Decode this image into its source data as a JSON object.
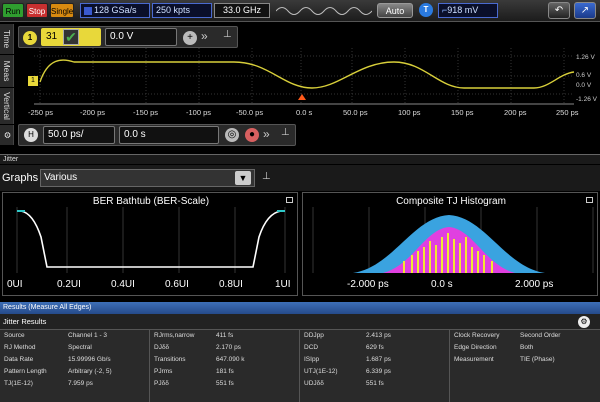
{
  "toolbar": {
    "run": "Run",
    "stop": "Stop",
    "single": "Single",
    "sample_rate": "128 GSa/s",
    "memory": "250 kpts",
    "bandwidth": "33.0 GHz",
    "auto": "Auto",
    "trigger_level": "918 mV"
  },
  "side_tabs": {
    "time": "Time",
    "meas": "Meas",
    "vertical": "Vertical"
  },
  "channel": {
    "offset_value": "0.0 V",
    "scale_value": "31"
  },
  "waveform": {
    "x_ticks": [
      "-250 ps",
      "-200 ps",
      "-150 ps",
      "-100 ps",
      "-50.0 ps",
      "0.0 s",
      "50.0 ps",
      "100 ps",
      "150 ps",
      "200 ps",
      "250 ps"
    ],
    "y_ticks": [
      "1.26 V",
      "0.6 V",
      "0.0 V",
      "-1.26 V"
    ],
    "marker": "1"
  },
  "horizontal": {
    "scale": "50.0 ps/",
    "position": "0.0 s",
    "h_label": "H"
  },
  "jitter": {
    "header": "Jitter",
    "graphs_label": "Graphs",
    "graphs_value": "Various",
    "bathtub": {
      "title": "BER Bathtub (BER-Scale)",
      "ticks": [
        "0UI",
        "0.2UI",
        "0.4UI",
        "0.6UI",
        "0.8UI",
        "1UI"
      ]
    },
    "histogram": {
      "title": "Composite TJ Histogram",
      "ticks": [
        "-2.000 ps",
        "0.0 s",
        "2.000 ps"
      ]
    }
  },
  "results": {
    "header": "Results   (Measure All Edges)",
    "subheader": "Jitter Results",
    "columns": [
      [
        [
          "Source",
          "Channel 1 - 3"
        ],
        [
          "RJ Method",
          "Spectral"
        ],
        [
          "Data Rate",
          "15.99996 Gb/s"
        ],
        [
          "Pattern Length",
          "Arbitrary (-2, 5)"
        ],
        [
          "TJ(1E-12)",
          "7.959 ps"
        ]
      ],
      [
        [
          "RJrms,narrow",
          "411 fs"
        ],
        [
          "DJδδ",
          "2.170 ps"
        ],
        [
          "Transitions",
          "647.090 k"
        ],
        [
          "PJrms",
          "181 fs"
        ],
        [
          "PJδδ",
          "551 fs"
        ]
      ],
      [
        [
          "DDJpp",
          "2.413 ps"
        ],
        [
          "DCD",
          "629 fs"
        ],
        [
          "ISIpp",
          "1.687 ps"
        ],
        [
          "UTJ(1E-12)",
          "6.339 ps"
        ],
        [
          "UDJδδ",
          "551 fs"
        ]
      ],
      [
        [
          "Clock Recovery",
          "Second Order"
        ],
        [
          "Edge Direction",
          "Both"
        ],
        [
          "Measurement",
          "TIE (Phase)"
        ],
        [
          "",
          ""
        ],
        [
          "",
          ""
        ]
      ]
    ]
  },
  "colors": {
    "waveform": "#d8cf3a",
    "trigger": "#ff5a1a",
    "histogram_base": "#3aa3e0",
    "histogram_core": "#e040e0",
    "histogram_peaks": "#f2e830",
    "results_header": "#2f5ea4"
  }
}
